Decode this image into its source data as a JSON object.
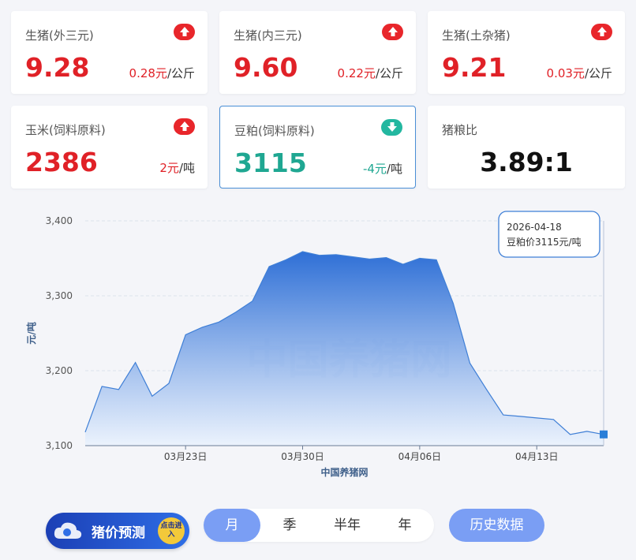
{
  "cards": [
    {
      "title": "生猪(外三元)",
      "price": "9.28",
      "change": "0.28元",
      "unit": "/公斤",
      "direction": "up"
    },
    {
      "title": "生猪(内三元)",
      "price": "9.60",
      "change": "0.22元",
      "unit": "/公斤",
      "direction": "up"
    },
    {
      "title": "生猪(土杂猪)",
      "price": "9.21",
      "change": "0.03元",
      "unit": "/公斤",
      "direction": "up"
    },
    {
      "title": "玉米(饲料原料)",
      "price": "2386",
      "change": "2元",
      "unit": "/吨",
      "direction": "up"
    },
    {
      "title": "豆粕(饲料原料)",
      "price": "3115",
      "change": "-4元",
      "unit": "/吨",
      "direction": "down"
    },
    {
      "title": "猪粮比",
      "price": "3.89:1"
    }
  ],
  "chart_data": {
    "type": "area",
    "ylabel": "元/吨",
    "xlabel": "中国养猪网",
    "watermark": "中国养猪网",
    "ylim": [
      3100,
      3400
    ],
    "yticks": [
      "3,100",
      "3,200",
      "3,300",
      "3,400"
    ],
    "xticks": [
      "03月23日",
      "03月30日",
      "04月06日",
      "04月13日"
    ],
    "series": [
      {
        "values": [
          3118,
          3179,
          3175,
          3211,
          3166,
          3183,
          3248,
          3258,
          3265,
          3278,
          3293,
          3339,
          3348,
          3359,
          3354,
          3355,
          3352,
          3349,
          3351,
          3342,
          3350,
          3348,
          3290,
          3210,
          3175,
          3141,
          3139,
          3137,
          3135,
          3115,
          3119,
          3115
        ]
      }
    ],
    "tooltip": {
      "date": "2026-04-18",
      "text": "豆粕价3115元/吨"
    },
    "colors": {
      "line": "#3f7fd6",
      "fill_top": "#2e6fd6",
      "fill_bottom": "#eaf2fd",
      "marker": "#2b7fd8"
    }
  },
  "controls": {
    "forecast_label": "猪价预测",
    "forecast_badge": "点击进入",
    "periods": [
      "月",
      "季",
      "半年",
      "年"
    ],
    "active_period": "月",
    "history_label": "历史数据"
  }
}
